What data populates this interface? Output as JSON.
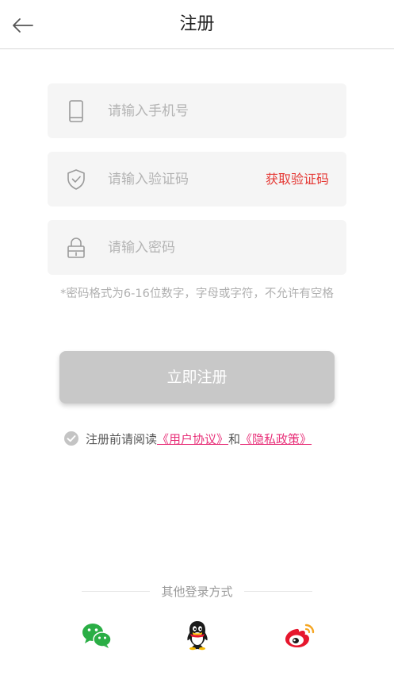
{
  "header": {
    "title": "注册",
    "back_icon": "arrow-left-icon"
  },
  "form": {
    "phone": {
      "placeholder": "请输入手机号",
      "value": "",
      "icon": "phone-icon"
    },
    "code": {
      "placeholder": "请输入验证码",
      "value": "",
      "icon": "shield-check-icon",
      "action_label": "获取验证码"
    },
    "password": {
      "placeholder": "请输入密码",
      "value": "",
      "icon": "lock-icon"
    },
    "hint": "*密码格式为6-16位数字，字母或字符，不允许有空格"
  },
  "register_button": {
    "label": "立即注册"
  },
  "agreement": {
    "prefix": "注册前请阅读",
    "user_agreement": "《用户协议》",
    "and": "和",
    "privacy_policy": "《隐私政策》"
  },
  "other_login": {
    "label": "其他登录方式",
    "providers": [
      "wechat-icon",
      "qq-icon",
      "weibo-icon"
    ]
  },
  "colors": {
    "accent_red": "#e53935",
    "link_pink": "#e8327a",
    "button_disabled": "#c8c8c8",
    "field_bg": "#f5f5f5",
    "wechat_green": "#2aae45",
    "weibo_red": "#e6162d",
    "weibo_orange": "#f5a623"
  }
}
